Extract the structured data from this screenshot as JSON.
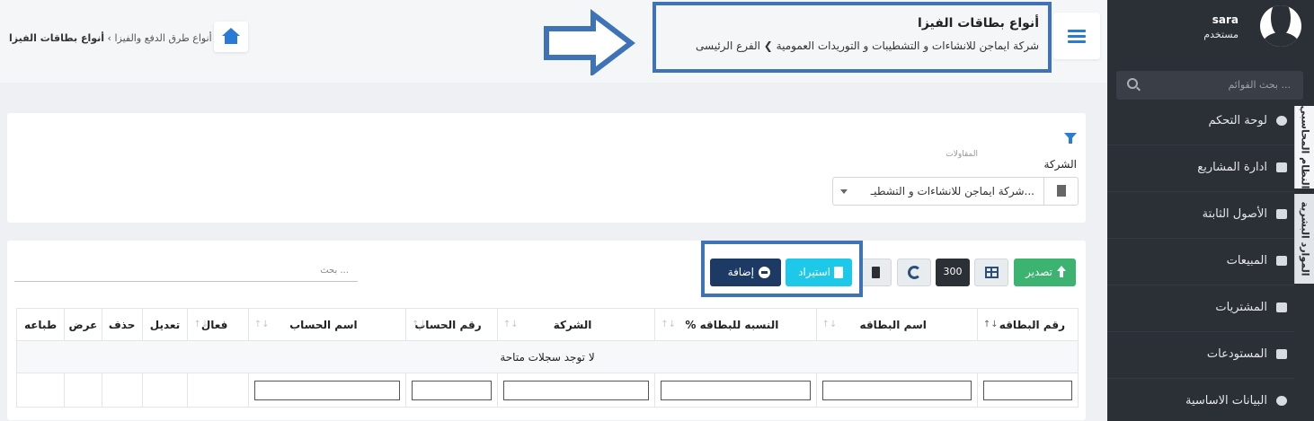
{
  "user": {
    "name": "sara",
    "role": "مستخدم"
  },
  "sidebar": {
    "search_placeholder": "بحث القوائم ...",
    "items": [
      {
        "label": "لوحة التحكم",
        "icon": "dashboard-icon"
      },
      {
        "label": "ادارة المشاريع",
        "icon": "handshake-icon"
      },
      {
        "label": "الأصول الثابتة",
        "icon": "file-icon"
      },
      {
        "label": "المبيعات",
        "icon": "truck-icon"
      },
      {
        "label": "المشتريات",
        "icon": "money-icon"
      },
      {
        "label": "المستودعات",
        "icon": "archive-icon"
      },
      {
        "label": "البيانات الاساسية",
        "icon": "info-icon"
      }
    ],
    "vertical_tabs": [
      "النظام المحاسبي",
      "الموارد البشرية"
    ]
  },
  "header": {
    "title": "أنواع بطاقات الفيزا",
    "path_company": "شركة ايماجن للانشاءات و التشطيبات و التوريدات العمومية",
    "path_branch": "الفرع الرئيسى",
    "breadcrumb_parent": "أنواع طرق الدفع والفيزا",
    "breadcrumb_current": "أنواع بطاقات الفيزا"
  },
  "filter": {
    "hint": "المقاولات",
    "company_label": "الشركة",
    "company_value": "شركة ايماجن للانشاءات و التشطيـ..."
  },
  "toolbar": {
    "search_placeholder": "بحث ...",
    "export_label": "تصدير",
    "page_size": "300",
    "import_label": "استيراد",
    "add_label": "إضافة"
  },
  "table": {
    "columns": [
      "رقم البطاقه",
      "اسم البطاقه",
      "النسبه للبطاقه %",
      "الشركة",
      "رقم الحساب",
      "اسم الحساب",
      "فعال",
      "تعديل",
      "حذف",
      "عرض",
      "طباعه"
    ],
    "empty_message": "لا توجد سجلات متاحة"
  },
  "colors": {
    "sidebar_bg": "#2b2f36",
    "accent": "#2a7bd6",
    "highlight_box": "#3e73b8",
    "export": "#3cb371",
    "import": "#1ec8e8",
    "add": "#1c3a63"
  }
}
